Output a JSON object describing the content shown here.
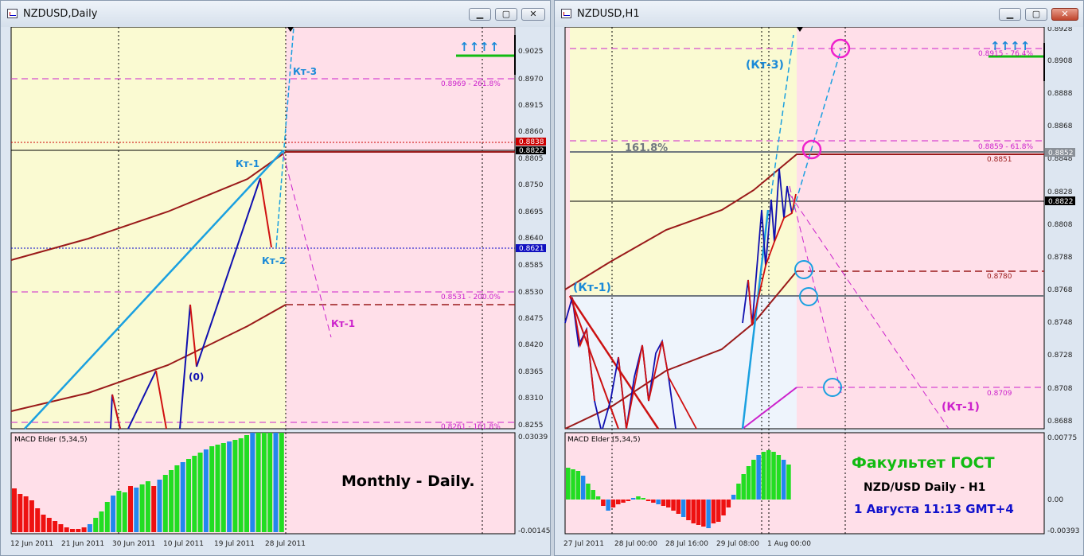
{
  "left_window": {
    "title": "NZDUSD,Daily",
    "price_labels": [
      "0.9025",
      "0.8970",
      "0.8915",
      "0.8860",
      "0.8805",
      "0.8750",
      "0.8695",
      "0.8640",
      "0.8585",
      "0.8530",
      "0.8475",
      "0.8420",
      "0.8365",
      "0.8310",
      "0.8255"
    ],
    "current_price_tags": [
      "0.8838",
      "0.8822"
    ],
    "level_tag_blue": "0.8621",
    "fib_labels": [
      "0.8969 - 261.8%",
      "0.8531 - 200.0%",
      "0.8261 - 161.8%"
    ],
    "wave_labels": [
      "Кт-3",
      "Кт-1",
      "Кт-2",
      "Кт-1",
      "(0)"
    ],
    "indicator_name": "MACD Elder (5,34,5)",
    "indicator_scale": [
      "0.03039",
      "-0.00145"
    ],
    "caption": "Monthly - Daily.",
    "date_labels": [
      "12 Jun 2011",
      "21 Jun 2011",
      "30 Jun 2011",
      "10 Jul 2011",
      "19 Jul 2011",
      "28 Jul 2011"
    ],
    "arrows": "↑↑↑↑"
  },
  "right_window": {
    "title": "NZDUSD,H1",
    "price_labels": [
      "0.8928",
      "0.8908",
      "0.8888",
      "0.8868",
      "0.8848",
      "0.8828",
      "0.8808",
      "0.8788",
      "0.8768",
      "0.8748",
      "0.8728",
      "0.8708",
      "0.8688"
    ],
    "current_price_tags": [
      "0.8852",
      "0.8822"
    ],
    "fib_labels": [
      "0.8915 - 76.4%",
      "0.8859 - 61.8%",
      "0.8851",
      "0.8780",
      "0.8709"
    ],
    "big_pct": "161.8%",
    "wave_labels": [
      "(Кт-3)",
      "(Кт-1)",
      "(Кт-1)"
    ],
    "indicator_name": "MACD Elder (5,34,5)",
    "indicator_scale": [
      "0.00775",
      "0.00",
      "-0.00393"
    ],
    "caption_lines": [
      "Факультет ГОСТ",
      "NZD/USD Daily - H1",
      "1 Августа 11:13 GMT+4"
    ],
    "date_labels": [
      "27 Jul 2011",
      "28 Jul 00:00",
      "28 Jul 16:00",
      "29 Jul 08:00",
      "1 Aug 00:00"
    ],
    "arrows": "↑↑↑↑"
  },
  "colors": {
    "upbar": "#1010b0",
    "downbar": "#d01010",
    "envelope": "#9a1a1a",
    "fib": "#cc22cc",
    "wave": "#1aa0e0",
    "macd_up": "#22dd22",
    "macd_down": "#ee1111",
    "macd_mid": "#2288ee"
  }
}
